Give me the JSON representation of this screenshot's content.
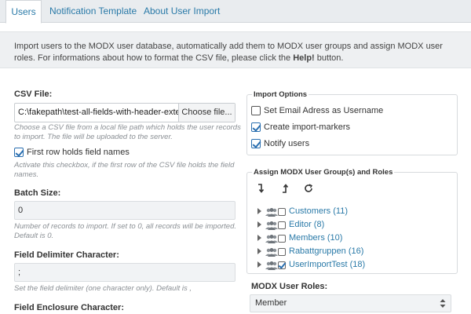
{
  "tabs": [
    {
      "label": "Users",
      "active": true
    },
    {
      "label": "Notification Template",
      "active": false
    },
    {
      "label": "About User Import",
      "active": false
    }
  ],
  "description": {
    "text_before": "Import users to the MODX user database, automatically add them to MODX user groups and assign MODX user roles. For informations about how to format the CSV file, please click the ",
    "bold": "Help!",
    "text_after": " button."
  },
  "form": {
    "csv_file": {
      "label": "CSV File:",
      "value": "C:\\fakepath\\test-all-fields-with-header-extend",
      "button": "Choose file...",
      "help": "Choose a CSV file from a local file path which holds the user records to import. The file will be uploaded to the server."
    },
    "first_row": {
      "label": "First row holds field names",
      "checked": true,
      "help": "Activate this checkbox, if the first row of the CSV file holds the field names."
    },
    "batch_size": {
      "label": "Batch Size:",
      "value": "0",
      "help": "Number of records to import. If set to 0, all records will be imported. Default is 0."
    },
    "delimiter": {
      "label": "Field Delimiter Character:",
      "value": ";",
      "help": "Set the field delimiter (one character only). Default is ,"
    },
    "enclosure": {
      "label": "Field Enclosure Character:"
    }
  },
  "import_options": {
    "legend": "Import Options",
    "items": [
      {
        "label": "Set Email Adress as Username",
        "checked": false
      },
      {
        "label": "Create import-markers",
        "checked": true
      },
      {
        "label": "Notify users",
        "checked": true
      }
    ]
  },
  "groups": {
    "legend": "Assign MODX User Group(s) and Roles",
    "toolbar": [
      "expand-all-icon",
      "collapse-all-icon",
      "refresh-icon"
    ],
    "items": [
      {
        "label": "Customers (11)",
        "checked": false
      },
      {
        "label": "Editor (8)",
        "checked": false
      },
      {
        "label": "Members (10)",
        "checked": false
      },
      {
        "label": "Rabattgruppen (16)",
        "checked": false
      },
      {
        "label": "UserImportTest (18)",
        "checked": true
      }
    ]
  },
  "roles": {
    "label": "MODX User Roles:",
    "selected": "Member"
  },
  "colors": {
    "link": "#2a7aa8",
    "check": "#2a6fb0",
    "panel": "#eef0f2"
  }
}
